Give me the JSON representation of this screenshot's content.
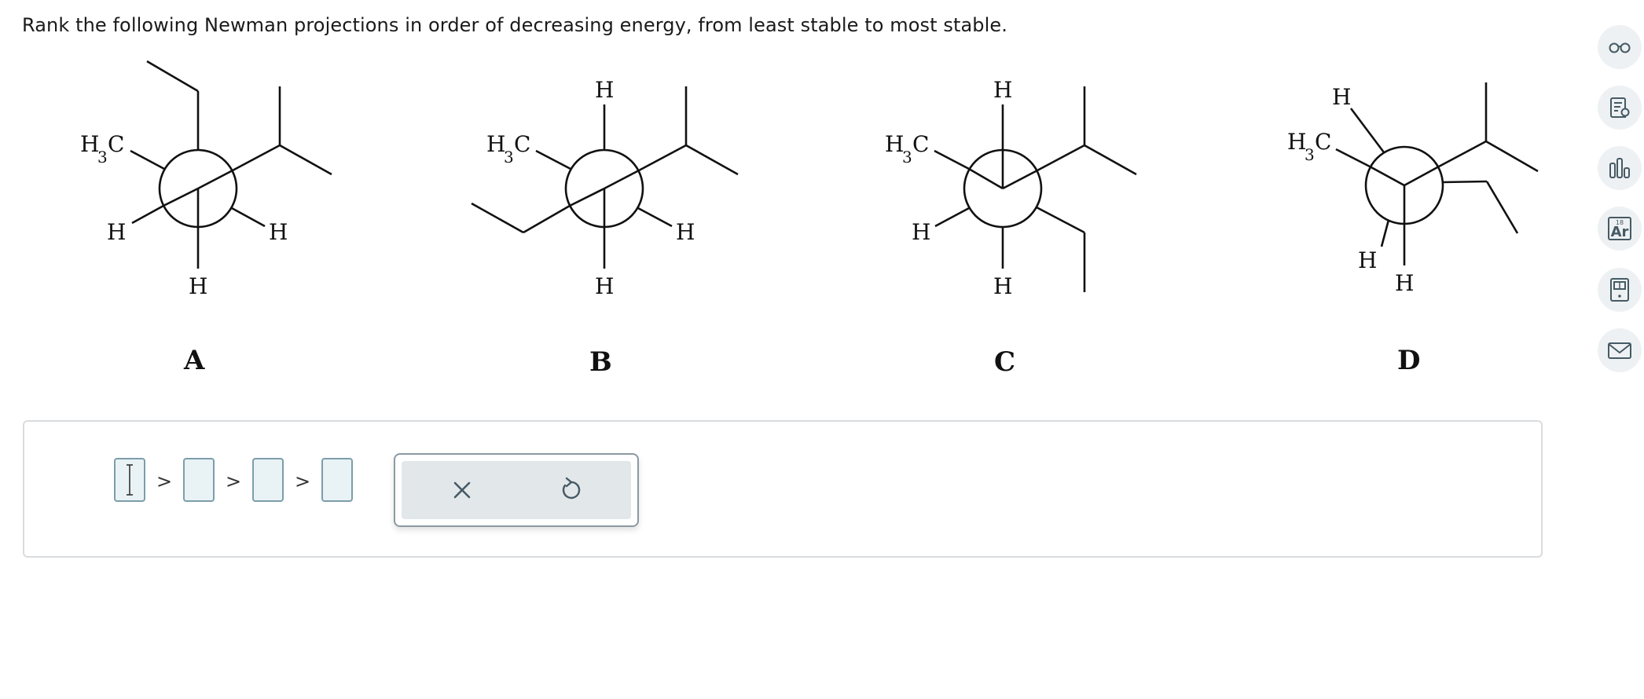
{
  "question": {
    "prompt": "Rank the following Newman projections in order of decreasing energy, from least stable to most stable."
  },
  "molecules": [
    {
      "label": "A",
      "h3c_h": "H",
      "h3c_sub": "3",
      "h3c_c": "C",
      "h_labels": [
        "H",
        "H",
        "H"
      ]
    },
    {
      "label": "B",
      "h3c_h": "H",
      "h3c_sub": "3",
      "h3c_c": "C",
      "h_labels": [
        "H",
        "H",
        "H"
      ]
    },
    {
      "label": "C",
      "h3c_h": "H",
      "h3c_sub": "3",
      "h3c_c": "C",
      "h_labels": [
        "H",
        "H",
        "H"
      ]
    },
    {
      "label": "D",
      "h3c_h": "H",
      "h3c_sub": "3",
      "h3c_c": "C",
      "h_labels": [
        "H",
        "H",
        "H"
      ]
    }
  ],
  "answer": {
    "separators": [
      ">",
      ">",
      ">"
    ],
    "slots": [
      "",
      "",
      "",
      ""
    ]
  },
  "tools": {
    "clear_icon": "x-icon",
    "undo_icon": "undo-icon"
  },
  "sidebar": {
    "icons": [
      "glasses-icon",
      "notes-icon",
      "bar-chart-icon",
      "periodic-table-icon",
      "calculator-icon",
      "mail-icon"
    ],
    "periodic_table": {
      "number": "18",
      "symbol": "Ar"
    }
  }
}
